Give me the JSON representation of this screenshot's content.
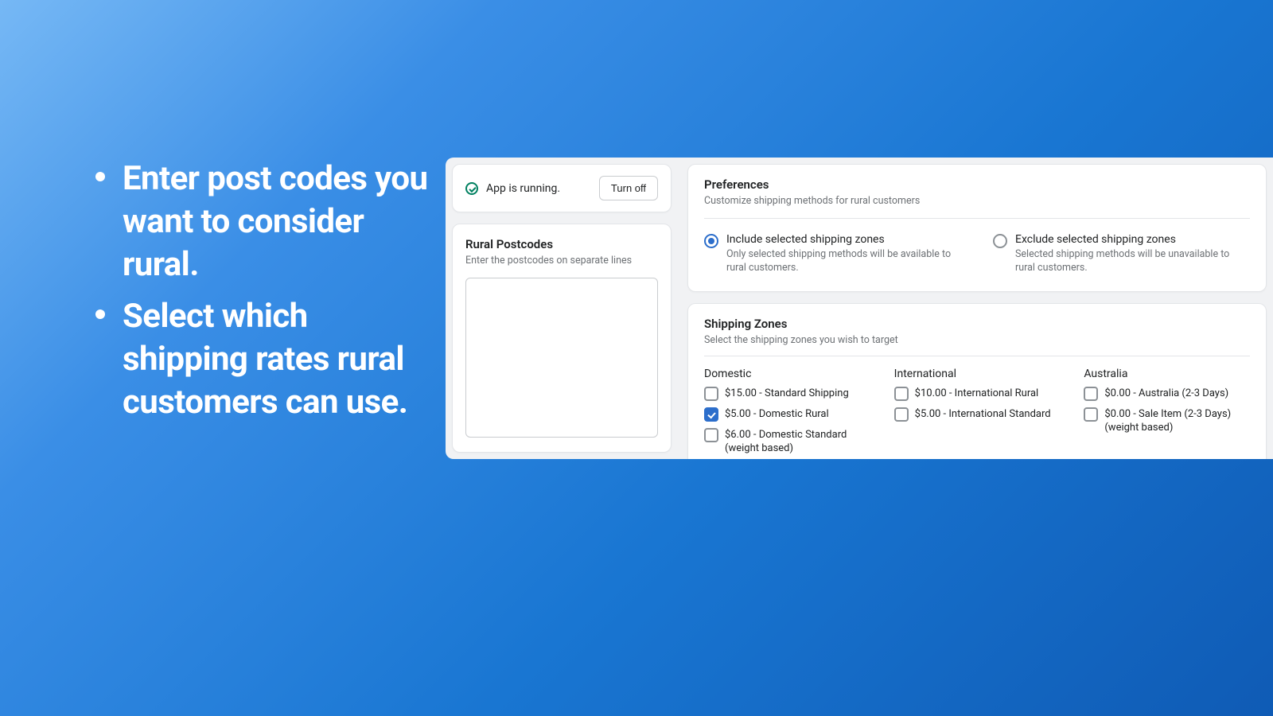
{
  "promo": {
    "bullets": [
      "Enter post codes you want to consider rural.",
      "Select which shipping rates rural customers can use."
    ]
  },
  "status": {
    "text": "App is running.",
    "button": "Turn off"
  },
  "postcodes": {
    "title": "Rural Postcodes",
    "subtitle": "Enter the postcodes on separate lines",
    "value": ""
  },
  "preferences": {
    "title": "Preferences",
    "subtitle": "Customize shipping methods for rural customers",
    "options": [
      {
        "label": "Include selected shipping zones",
        "desc": "Only selected shipping methods will be available to rural customers.",
        "selected": true
      },
      {
        "label": "Exclude selected shipping zones",
        "desc": "Selected shipping methods will be unavailable to rural customers.",
        "selected": false
      }
    ]
  },
  "zones": {
    "title": "Shipping Zones",
    "subtitle": "Select the shipping zones you wish to target",
    "columns": [
      {
        "title": "Domestic",
        "items": [
          {
            "label": "$15.00 - Standard Shipping",
            "checked": false
          },
          {
            "label": "$5.00 - Domestic Rural",
            "checked": true
          },
          {
            "label": "$6.00 - Domestic Standard (weight based)",
            "checked": false
          }
        ]
      },
      {
        "title": "International",
        "items": [
          {
            "label": "$10.00 - International Rural",
            "checked": false
          },
          {
            "label": "$5.00 - International Standard",
            "checked": false
          }
        ]
      },
      {
        "title": "Australia",
        "items": [
          {
            "label": "$0.00 - Australia (2-3 Days)",
            "checked": false
          },
          {
            "label": "$0.00 - Sale Item (2-3 Days) (weight based)",
            "checked": false
          }
        ]
      }
    ]
  }
}
